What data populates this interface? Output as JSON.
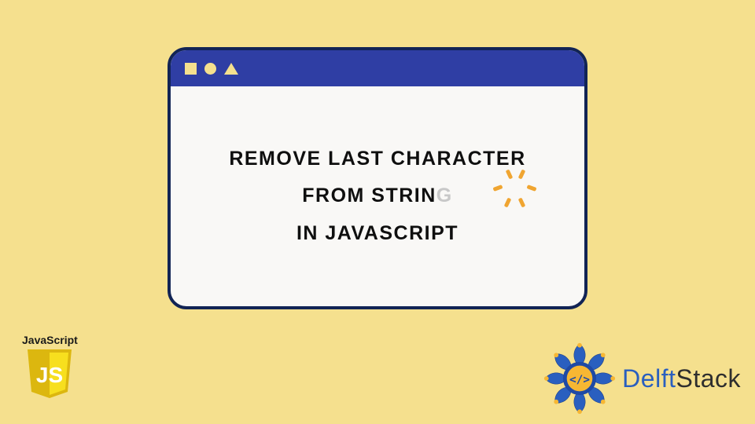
{
  "window": {
    "heading_line1": "REMOVE LAST CHARACTER",
    "heading_line2_prefix": "FROM STRIN",
    "heading_line2_fade": "G",
    "heading_line3": "IN JAVASCRIPT"
  },
  "logos": {
    "js_label": "JavaScript",
    "js_text": "JS",
    "delft_prefix": "Delft",
    "delft_suffix": "Stack",
    "delft_code": "</>"
  },
  "colors": {
    "background": "#f5e08e",
    "titlebar": "#2f3ea4",
    "window_border": "#122455",
    "burst": "#f0a531",
    "js_yellow": "#f7df1e",
    "delft_blue": "#2a5fbf"
  },
  "icons": {
    "titlebar_shapes": [
      "square",
      "circle",
      "triangle"
    ]
  }
}
